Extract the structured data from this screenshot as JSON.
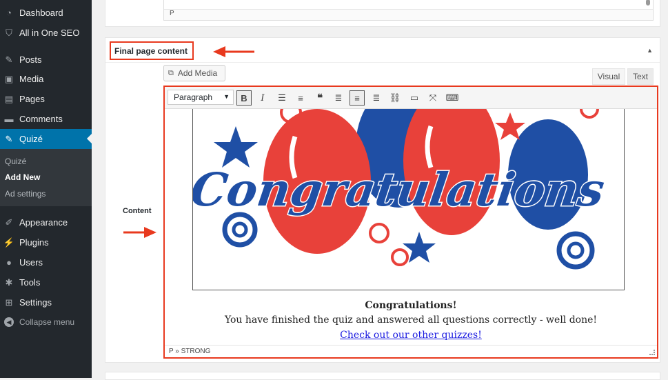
{
  "sidebar": {
    "items": [
      {
        "label": "Dashboard",
        "icon": "dashboard-icon"
      },
      {
        "label": "All in One SEO",
        "icon": "shield-icon"
      },
      {
        "label": "Posts",
        "icon": "pin-icon"
      },
      {
        "label": "Media",
        "icon": "media-icon"
      },
      {
        "label": "Pages",
        "icon": "pages-icon"
      },
      {
        "label": "Comments",
        "icon": "comment-icon"
      },
      {
        "label": "Quizé",
        "icon": "pin-icon"
      },
      {
        "label": "Appearance",
        "icon": "brush-icon"
      },
      {
        "label": "Plugins",
        "icon": "plugin-icon"
      },
      {
        "label": "Users",
        "icon": "user-icon"
      },
      {
        "label": "Tools",
        "icon": "wrench-icon"
      },
      {
        "label": "Settings",
        "icon": "settings-icon"
      }
    ],
    "submenu": [
      "Quizé",
      "Add New",
      "Ad settings"
    ],
    "collapse_label": "Collapse menu"
  },
  "top_panel": {
    "status": "P"
  },
  "main_panel": {
    "title": "Final page content",
    "add_media_label": "Add Media",
    "tab_visual": "Visual",
    "tab_text": "Text",
    "content_label": "Content",
    "toolbar": {
      "format_value": "Paragraph"
    },
    "document": {
      "image_text": "Congratulations",
      "title": "Congratulations!",
      "body": "You have finished the quiz and answered all questions correctly - well done!",
      "link": "Check out our other quizzes!"
    },
    "status_path": "P » STRONG"
  },
  "colors": {
    "accent": "#0073aa",
    "highlight": "#e8391e",
    "sidebar": "#23282d",
    "balloon_red": "#e8413a",
    "balloon_blue": "#1f4fa5"
  }
}
